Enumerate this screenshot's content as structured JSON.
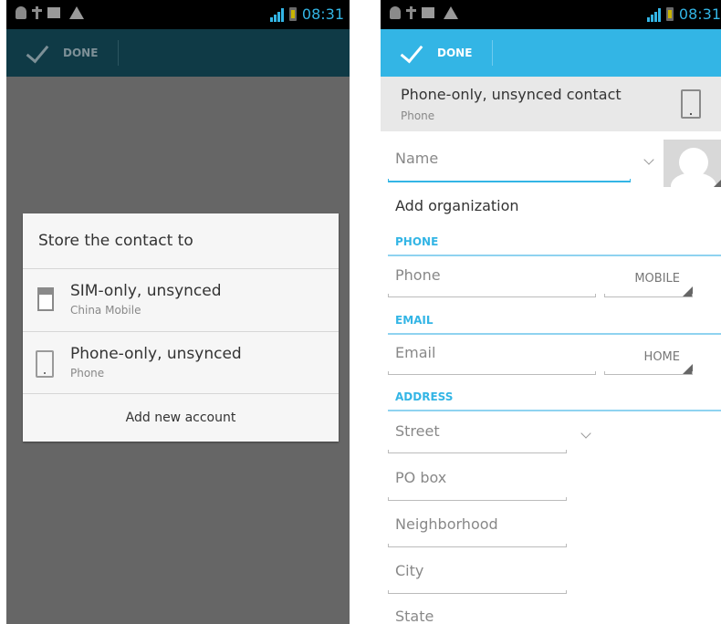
{
  "status_bar": {
    "time": "08:31"
  },
  "left_screen": {
    "action_bar": {
      "done_label": "DONE"
    },
    "dialog": {
      "title": "Store the contact to",
      "accounts": [
        {
          "name": "SIM-only, unsynced",
          "subtitle": "China Mobile",
          "icon": "sim-card-icon"
        },
        {
          "name": "Phone-only, unsynced",
          "subtitle": "Phone",
          "icon": "phone-device-icon"
        }
      ],
      "add_account_label": "Add new account"
    }
  },
  "right_screen": {
    "action_bar": {
      "done_label": "DONE"
    },
    "account_header": {
      "name": "Phone-only, unsynced contact",
      "subtitle": "Phone",
      "icon": "phone-device-icon"
    },
    "form": {
      "name_placeholder": "Name",
      "organization_label": "Add organization",
      "phone_section": "PHONE",
      "phone_placeholder": "Phone",
      "phone_type": "MOBILE",
      "email_section": "EMAIL",
      "email_placeholder": "Email",
      "email_type": "HOME",
      "address_section": "ADDRESS",
      "street_placeholder": "Street",
      "pobox_placeholder": "PO box",
      "neighborhood_placeholder": "Neighborhood",
      "city_placeholder": "City",
      "state_placeholder": "State"
    }
  },
  "colors": {
    "accent": "#33b5e5",
    "dim_overlay": "#666666",
    "dark_action_bar": "#0f3a46"
  }
}
